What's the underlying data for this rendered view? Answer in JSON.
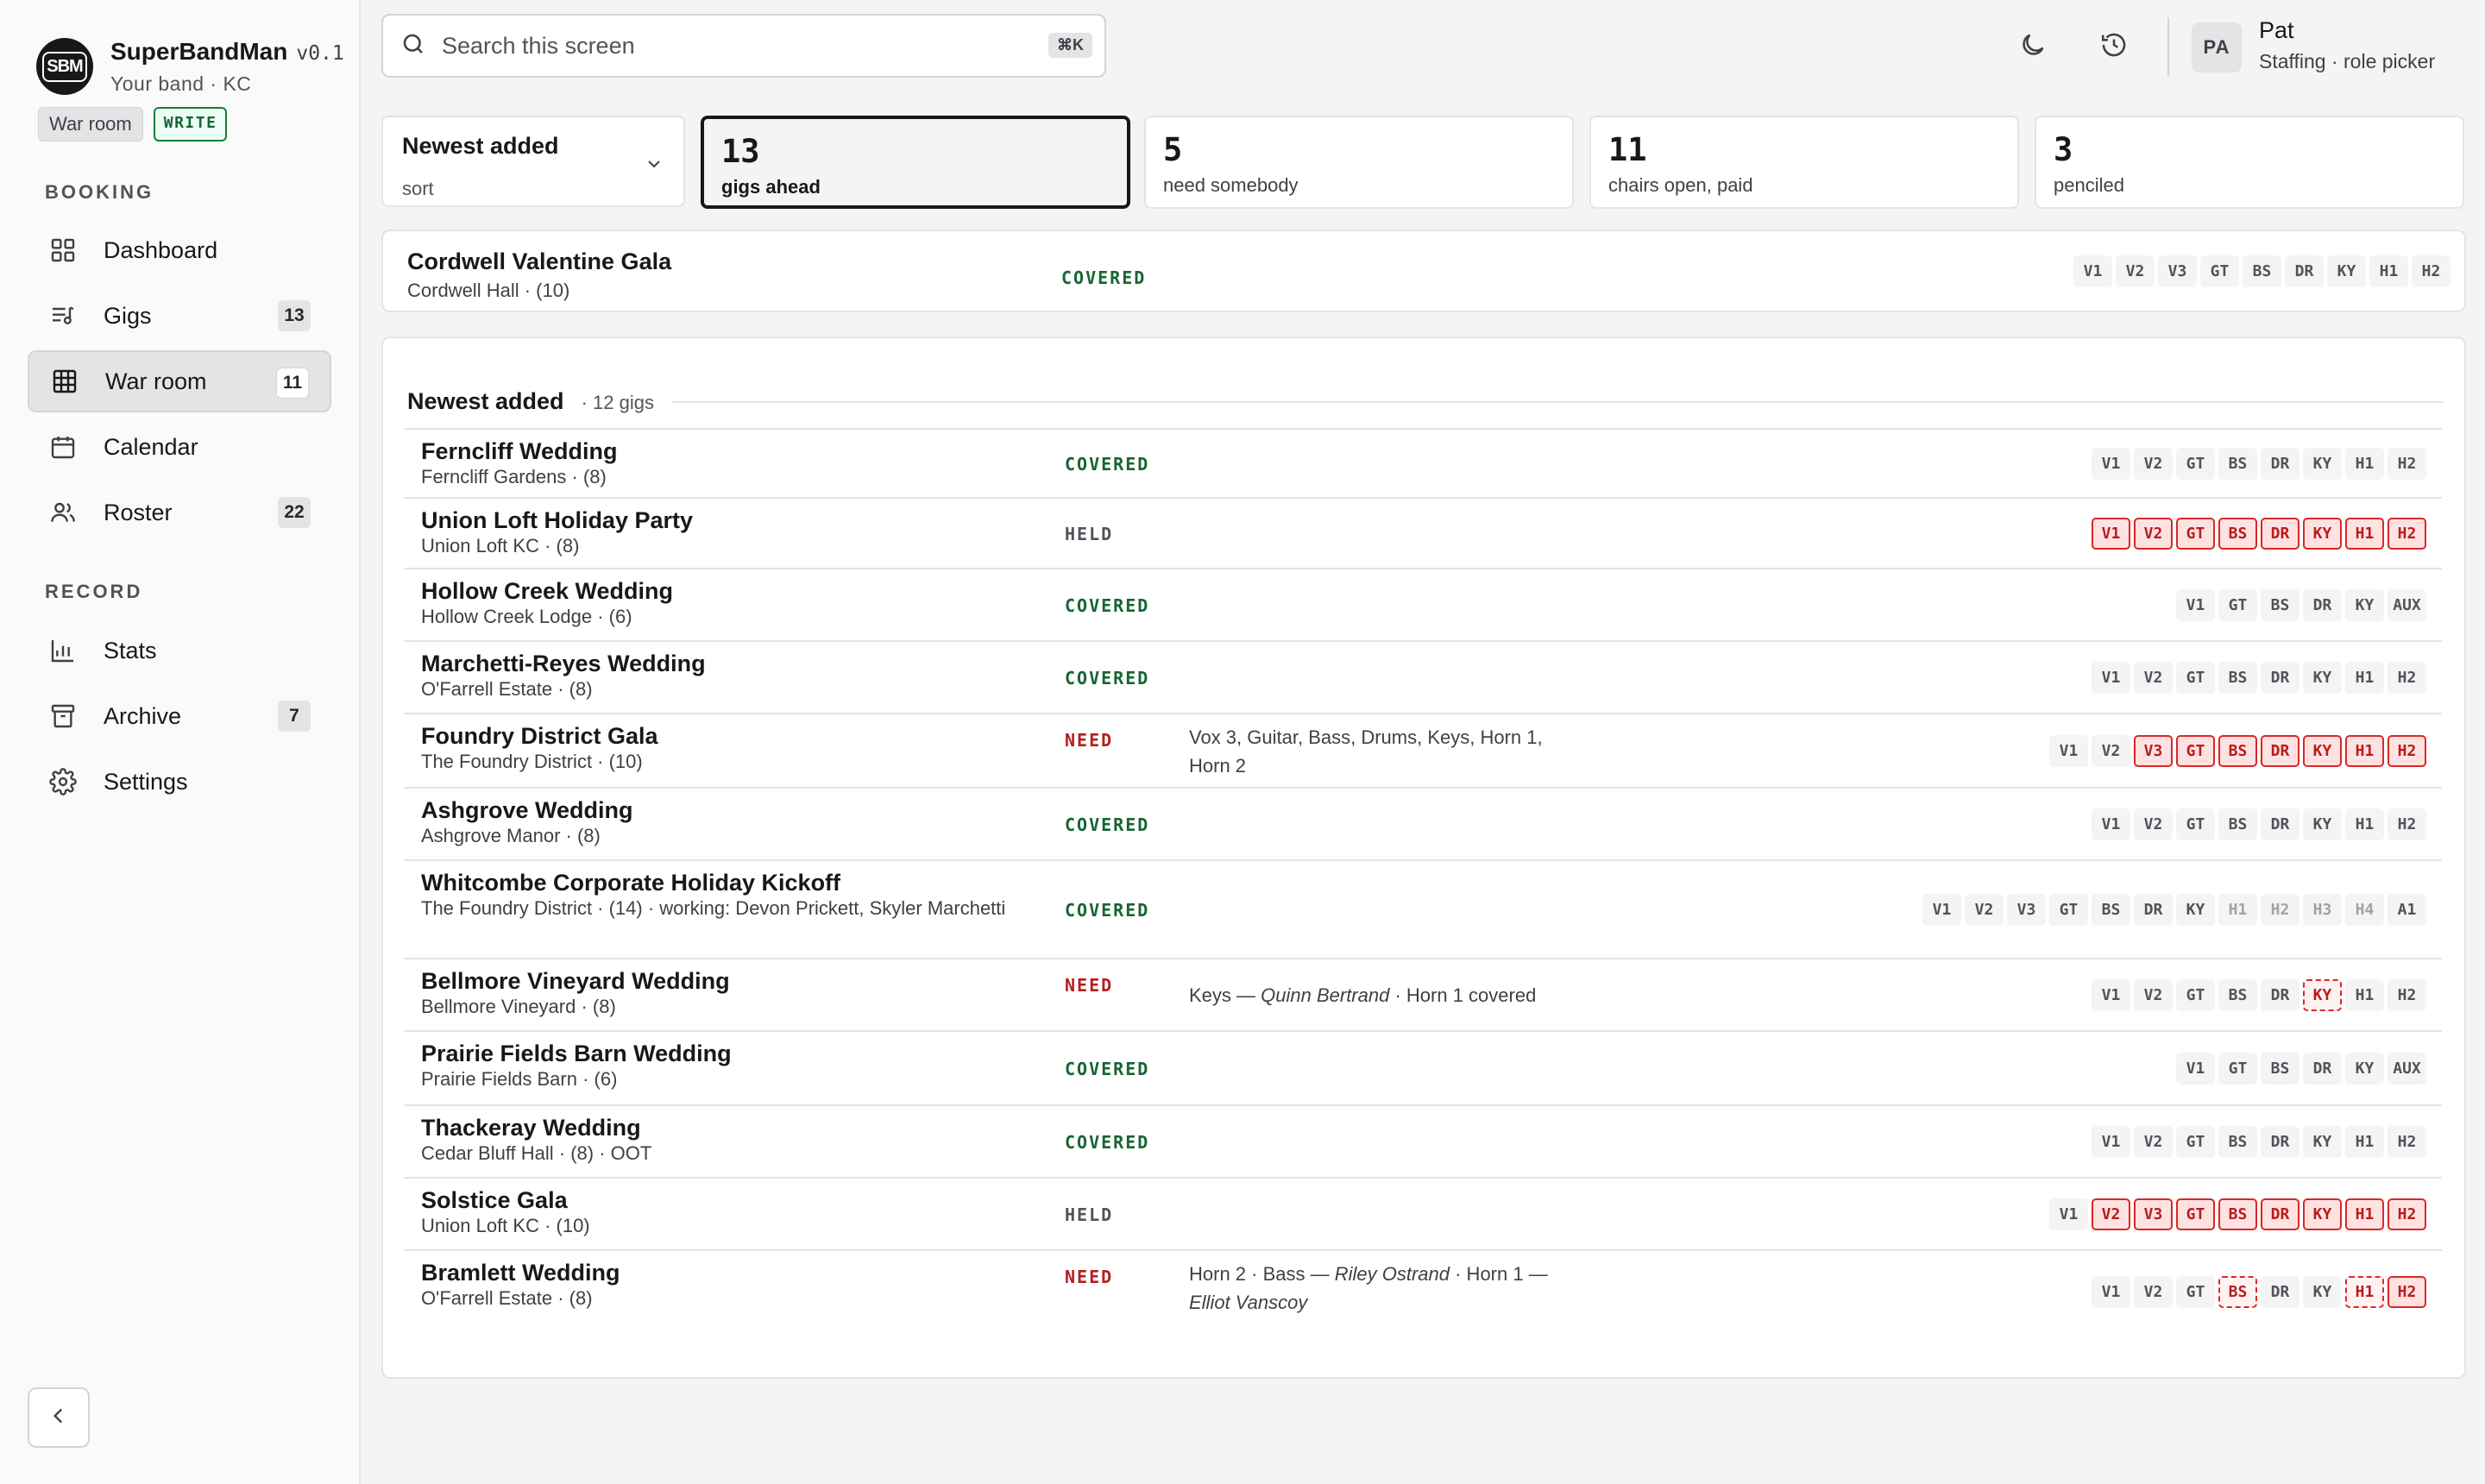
{
  "app": {
    "name": "SuperBandMan",
    "version": "v0.1",
    "logo_text": "SBM",
    "subtitle": "Your band · KC",
    "page_chip": "War room",
    "mode_chip": "WRITE"
  },
  "sidebar": {
    "sections": {
      "booking": "BOOKING",
      "record": "RECORD"
    },
    "items": [
      {
        "label": "Dashboard",
        "count": "",
        "icon": "grid-icon"
      },
      {
        "label": "Gigs",
        "count": "13",
        "icon": "list-music-icon"
      },
      {
        "label": "War room",
        "count": "11",
        "icon": "table-grid-icon",
        "active": true
      },
      {
        "label": "Calendar",
        "count": "",
        "icon": "calendar-icon"
      },
      {
        "label": "Roster",
        "count": "22",
        "icon": "users-icon"
      },
      {
        "label": "Stats",
        "count": "",
        "icon": "bar-chart-icon"
      },
      {
        "label": "Archive",
        "count": "7",
        "icon": "archive-icon"
      },
      {
        "label": "Settings",
        "count": "",
        "icon": "gear-icon"
      }
    ]
  },
  "topbar": {
    "search_placeholder": "Search this screen",
    "search_shortcut": "⌘K",
    "user": {
      "initials": "PA",
      "name": "Pat",
      "role": "Staffing · role picker"
    }
  },
  "summary": {
    "sort": {
      "value": "Newest added",
      "label": "sort"
    },
    "stats": [
      {
        "number": "13",
        "label": "gigs ahead"
      },
      {
        "number": "5",
        "label": "need somebody"
      },
      {
        "number": "11",
        "label": "chairs open, paid"
      },
      {
        "number": "3",
        "label": "penciled"
      }
    ]
  },
  "pinned": {
    "name": "Cordwell Valentine Gala",
    "venue": "Cordwell Hall · (10)",
    "status": "COVERED",
    "chairs": [
      [
        "V1",
        "ok"
      ],
      [
        "V2",
        "ok"
      ],
      [
        "V3",
        "ok"
      ],
      [
        "GT",
        "ok"
      ],
      [
        "BS",
        "ok"
      ],
      [
        "DR",
        "ok"
      ],
      [
        "KY",
        "ok"
      ],
      [
        "H1",
        "ok"
      ],
      [
        "H2",
        "ok"
      ]
    ]
  },
  "group": {
    "title": "Newest added",
    "count": "· 12 gigs"
  },
  "gigs": [
    {
      "name": "Ferncliff Wedding",
      "venue": "Ferncliff Gardens · (8)",
      "status": "COVERED",
      "chairs": [
        [
          "V1",
          "ok"
        ],
        [
          "V2",
          "ok"
        ],
        [
          "GT",
          "ok"
        ],
        [
          "BS",
          "ok"
        ],
        [
          "DR",
          "ok"
        ],
        [
          "KY",
          "ok"
        ],
        [
          "H1",
          "ok"
        ],
        [
          "H2",
          "ok"
        ]
      ]
    },
    {
      "name": "Union Loft Holiday Party",
      "venue": "Union Loft KC · (8)",
      "status": "HELD",
      "chairs": [
        [
          "V1",
          "gap"
        ],
        [
          "V2",
          "gap"
        ],
        [
          "GT",
          "gap"
        ],
        [
          "BS",
          "gap"
        ],
        [
          "DR",
          "gap"
        ],
        [
          "KY",
          "gap"
        ],
        [
          "H1",
          "gap"
        ],
        [
          "H2",
          "gap"
        ]
      ]
    },
    {
      "name": "Hollow Creek Wedding",
      "venue": "Hollow Creek Lodge · (6)",
      "status": "COVERED",
      "chairs": [
        [
          "V1",
          "ok"
        ],
        [
          "GT",
          "ok"
        ],
        [
          "BS",
          "ok"
        ],
        [
          "DR",
          "ok"
        ],
        [
          "KY",
          "ok"
        ],
        [
          "AUX",
          "ok"
        ]
      ]
    },
    {
      "name": "Marchetti-Reyes Wedding",
      "venue": "O'Farrell Estate · (8)",
      "status": "COVERED",
      "chairs": [
        [
          "V1",
          "ok"
        ],
        [
          "V2",
          "ok"
        ],
        [
          "GT",
          "ok"
        ],
        [
          "BS",
          "ok"
        ],
        [
          "DR",
          "ok"
        ],
        [
          "KY",
          "ok"
        ],
        [
          "H1",
          "ok"
        ],
        [
          "H2",
          "ok"
        ]
      ]
    },
    {
      "name": "Foundry District Gala",
      "venue": "The Foundry District · (10)",
      "status": "NEED",
      "note": [
        {
          "t": "Vox 3, Guitar, Bass, Drums, Keys, Horn 1,"
        },
        {
          "t": "Horn 2",
          "br": true
        }
      ],
      "chairs": [
        [
          "V1",
          "ok"
        ],
        [
          "V2",
          "ok"
        ],
        [
          "V3",
          "gap"
        ],
        [
          "GT",
          "gap"
        ],
        [
          "BS",
          "gap"
        ],
        [
          "DR",
          "gap"
        ],
        [
          "KY",
          "gap"
        ],
        [
          "H1",
          "gap"
        ],
        [
          "H2",
          "gap"
        ]
      ]
    },
    {
      "name": "Ashgrove Wedding",
      "venue": "Ashgrove Manor · (8)",
      "status": "COVERED",
      "chairs": [
        [
          "V1",
          "ok"
        ],
        [
          "V2",
          "ok"
        ],
        [
          "GT",
          "ok"
        ],
        [
          "BS",
          "ok"
        ],
        [
          "DR",
          "ok"
        ],
        [
          "KY",
          "ok"
        ],
        [
          "H1",
          "ok"
        ],
        [
          "H2",
          "ok"
        ]
      ]
    },
    {
      "name": "Whitcombe Corporate Holiday Kickoff",
      "venue": "The Foundry District · (14) · working: Devon Prickett, Skyler Marchetti",
      "status": "COVERED",
      "chairs": [
        [
          "V1",
          "ok"
        ],
        [
          "V2",
          "ok"
        ],
        [
          "V3",
          "ok"
        ],
        [
          "GT",
          "ok"
        ],
        [
          "BS",
          "ok"
        ],
        [
          "DR",
          "ok"
        ],
        [
          "KY",
          "ok"
        ],
        [
          "H1",
          "dim"
        ],
        [
          "H2",
          "dim"
        ],
        [
          "H3",
          "dim"
        ],
        [
          "H4",
          "dim"
        ],
        [
          "A1",
          "ok"
        ]
      ]
    },
    {
      "name": "Bellmore Vineyard Wedding",
      "venue": "Bellmore Vineyard · (8)",
      "status": "NEED",
      "note": [
        {
          "t": "Keys — "
        },
        {
          "t": "Quinn Bertrand",
          "i": true
        },
        {
          "t": " · Horn 1 covered"
        }
      ],
      "chairs": [
        [
          "V1",
          "ok"
        ],
        [
          "V2",
          "ok"
        ],
        [
          "GT",
          "ok"
        ],
        [
          "BS",
          "ok"
        ],
        [
          "DR",
          "ok"
        ],
        [
          "KY",
          "hold"
        ],
        [
          "H1",
          "ok"
        ],
        [
          "H2",
          "ok"
        ]
      ]
    },
    {
      "name": "Prairie Fields Barn Wedding",
      "venue": "Prairie Fields Barn · (6)",
      "status": "COVERED",
      "chairs": [
        [
          "V1",
          "ok"
        ],
        [
          "GT",
          "ok"
        ],
        [
          "BS",
          "ok"
        ],
        [
          "DR",
          "ok"
        ],
        [
          "KY",
          "ok"
        ],
        [
          "AUX",
          "ok"
        ]
      ]
    },
    {
      "name": "Thackeray Wedding",
      "venue": "Cedar Bluff Hall · (8) · OOT",
      "status": "COVERED",
      "chairs": [
        [
          "V1",
          "ok"
        ],
        [
          "V2",
          "ok"
        ],
        [
          "GT",
          "ok"
        ],
        [
          "BS",
          "ok"
        ],
        [
          "DR",
          "ok"
        ],
        [
          "KY",
          "ok"
        ],
        [
          "H1",
          "ok"
        ],
        [
          "H2",
          "ok"
        ]
      ]
    },
    {
      "name": "Solstice Gala",
      "venue": "Union Loft KC · (10)",
      "status": "HELD",
      "chairs": [
        [
          "V1",
          "ok"
        ],
        [
          "V2",
          "gap"
        ],
        [
          "V3",
          "gap"
        ],
        [
          "GT",
          "gap"
        ],
        [
          "BS",
          "gap"
        ],
        [
          "DR",
          "gap"
        ],
        [
          "KY",
          "gap"
        ],
        [
          "H1",
          "gap"
        ],
        [
          "H2",
          "gap"
        ]
      ]
    },
    {
      "name": "Bramlett Wedding",
      "venue": "O'Farrell Estate · (8)",
      "status": "NEED",
      "note": [
        {
          "t": "Horn 2 · Bass — "
        },
        {
          "t": "Riley Ostrand",
          "i": true
        },
        {
          "t": " · Horn 1 —"
        },
        {
          "t": "Elliot Vanscoy",
          "i": true,
          "br": true
        }
      ],
      "chairs": [
        [
          "V1",
          "ok"
        ],
        [
          "V2",
          "ok"
        ],
        [
          "GT",
          "ok"
        ],
        [
          "BS",
          "hold"
        ],
        [
          "DR",
          "ok"
        ],
        [
          "KY",
          "ok"
        ],
        [
          "H1",
          "hold"
        ],
        [
          "H2",
          "gap"
        ]
      ]
    }
  ]
}
